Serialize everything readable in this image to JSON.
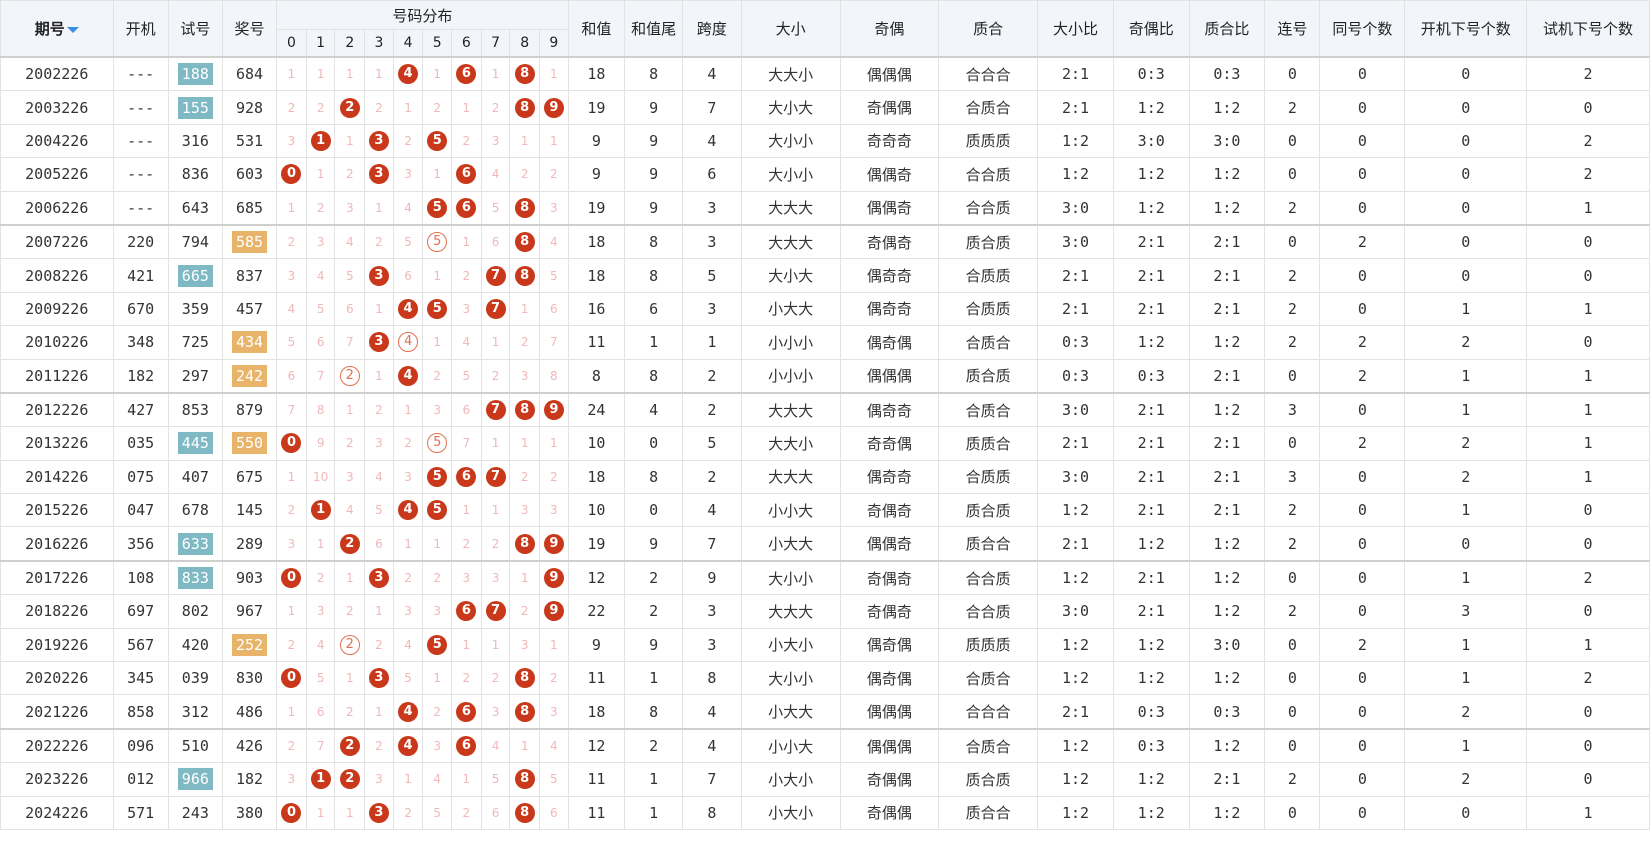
{
  "header": {
    "period": "期号",
    "open_machine": "开机",
    "trial": "试号",
    "prize": "奖号",
    "distribution": "号码分布",
    "digits": [
      "0",
      "1",
      "2",
      "3",
      "4",
      "5",
      "6",
      "7",
      "8",
      "9"
    ],
    "sum": "和值",
    "sum_tail": "和值尾",
    "span": "跨度",
    "big_small": "大小",
    "odd_even": "奇偶",
    "prime_comp": "质合",
    "bs_ratio": "大小比",
    "oe_ratio": "奇偶比",
    "pc_ratio": "质合比",
    "consecutive": "连号",
    "same_count": "同号个数",
    "open_next_count": "开机下号个数",
    "trial_next_count": "试机下号个数"
  },
  "colors": {
    "ball": "#c9381a",
    "ring": "#e07050",
    "tag_teal": "#7fb9c4",
    "tag_orange": "#e8b46a",
    "header_bg": "#f2f6fb",
    "missing": "#f0b8b8"
  },
  "rows": [
    {
      "period": "2002226",
      "open": "---",
      "trial": "188",
      "trial_tag": "teal",
      "prize": "684",
      "prize_tag": "",
      "dist": [
        "1",
        "1",
        "1",
        "1",
        "B4",
        "1",
        "B6",
        "1",
        "B8",
        "1"
      ],
      "sum": "18",
      "tail": "8",
      "span": "4",
      "bs": "大大小",
      "oe": "偶偶偶",
      "pc": "合合合",
      "bsr": "2:1",
      "oer": "0:3",
      "pcr": "0:3",
      "cons": "0",
      "same": "0",
      "onext": "0",
      "tnext": "2"
    },
    {
      "period": "2003226",
      "open": "---",
      "trial": "155",
      "trial_tag": "teal",
      "prize": "928",
      "prize_tag": "",
      "dist": [
        "2",
        "2",
        "B2",
        "2",
        "1",
        "2",
        "1",
        "2",
        "B8",
        "B9"
      ],
      "sum": "19",
      "tail": "9",
      "span": "7",
      "bs": "大小大",
      "oe": "奇偶偶",
      "pc": "合质合",
      "bsr": "2:1",
      "oer": "1:2",
      "pcr": "1:2",
      "cons": "2",
      "same": "0",
      "onext": "0",
      "tnext": "0"
    },
    {
      "period": "2004226",
      "open": "---",
      "trial": "316",
      "trial_tag": "",
      "prize": "531",
      "prize_tag": "",
      "dist": [
        "3",
        "B1",
        "1",
        "B3",
        "2",
        "B5",
        "2",
        "3",
        "1",
        "1"
      ],
      "sum": "9",
      "tail": "9",
      "span": "4",
      "bs": "大小小",
      "oe": "奇奇奇",
      "pc": "质质质",
      "bsr": "1:2",
      "oer": "3:0",
      "pcr": "3:0",
      "cons": "0",
      "same": "0",
      "onext": "0",
      "tnext": "2"
    },
    {
      "period": "2005226",
      "open": "---",
      "trial": "836",
      "trial_tag": "",
      "prize": "603",
      "prize_tag": "",
      "dist": [
        "B0",
        "1",
        "2",
        "B3",
        "3",
        "1",
        "B6",
        "4",
        "2",
        "2"
      ],
      "sum": "9",
      "tail": "9",
      "span": "6",
      "bs": "大小小",
      "oe": "偶偶奇",
      "pc": "合合质",
      "bsr": "1:2",
      "oer": "1:2",
      "pcr": "1:2",
      "cons": "0",
      "same": "0",
      "onext": "0",
      "tnext": "2"
    },
    {
      "period": "2006226",
      "open": "---",
      "trial": "643",
      "trial_tag": "",
      "prize": "685",
      "prize_tag": "",
      "dist": [
        "1",
        "2",
        "3",
        "1",
        "4",
        "B5",
        "B6",
        "5",
        "B8",
        "3"
      ],
      "sum": "19",
      "tail": "9",
      "span": "3",
      "bs": "大大大",
      "oe": "偶偶奇",
      "pc": "合合质",
      "bsr": "3:0",
      "oer": "1:2",
      "pcr": "1:2",
      "cons": "2",
      "same": "0",
      "onext": "0",
      "tnext": "1"
    },
    {
      "period": "2007226",
      "open": "220",
      "trial": "794",
      "trial_tag": "",
      "prize": "585",
      "prize_tag": "orange",
      "dist": [
        "2",
        "3",
        "4",
        "2",
        "5",
        "R5",
        "1",
        "6",
        "B8",
        "4"
      ],
      "sum": "18",
      "tail": "8",
      "span": "3",
      "bs": "大大大",
      "oe": "奇偶奇",
      "pc": "质合质",
      "bsr": "3:0",
      "oer": "2:1",
      "pcr": "2:1",
      "cons": "0",
      "same": "2",
      "onext": "0",
      "tnext": "0"
    },
    {
      "period": "2008226",
      "open": "421",
      "trial": "665",
      "trial_tag": "teal",
      "prize": "837",
      "prize_tag": "",
      "dist": [
        "3",
        "4",
        "5",
        "B3",
        "6",
        "1",
        "2",
        "B7",
        "B8",
        "5"
      ],
      "sum": "18",
      "tail": "8",
      "span": "5",
      "bs": "大小大",
      "oe": "偶奇奇",
      "pc": "合质质",
      "bsr": "2:1",
      "oer": "2:1",
      "pcr": "2:1",
      "cons": "2",
      "same": "0",
      "onext": "0",
      "tnext": "0"
    },
    {
      "period": "2009226",
      "open": "670",
      "trial": "359",
      "trial_tag": "",
      "prize": "457",
      "prize_tag": "",
      "dist": [
        "4",
        "5",
        "6",
        "1",
        "B4",
        "B5",
        "3",
        "B7",
        "1",
        "6"
      ],
      "sum": "16",
      "tail": "6",
      "span": "3",
      "bs": "小大大",
      "oe": "偶奇奇",
      "pc": "合质质",
      "bsr": "2:1",
      "oer": "2:1",
      "pcr": "2:1",
      "cons": "2",
      "same": "0",
      "onext": "1",
      "tnext": "1"
    },
    {
      "period": "2010226",
      "open": "348",
      "trial": "725",
      "trial_tag": "",
      "prize": "434",
      "prize_tag": "orange",
      "dist": [
        "5",
        "6",
        "7",
        "B3",
        "R4",
        "1",
        "4",
        "1",
        "2",
        "7"
      ],
      "sum": "11",
      "tail": "1",
      "span": "1",
      "bs": "小小小",
      "oe": "偶奇偶",
      "pc": "合质合",
      "bsr": "0:3",
      "oer": "1:2",
      "pcr": "1:2",
      "cons": "2",
      "same": "2",
      "onext": "2",
      "tnext": "0"
    },
    {
      "period": "2011226",
      "open": "182",
      "trial": "297",
      "trial_tag": "",
      "prize": "242",
      "prize_tag": "orange",
      "dist": [
        "6",
        "7",
        "R2",
        "1",
        "B4",
        "2",
        "5",
        "2",
        "3",
        "8"
      ],
      "sum": "8",
      "tail": "8",
      "span": "2",
      "bs": "小小小",
      "oe": "偶偶偶",
      "pc": "质合质",
      "bsr": "0:3",
      "oer": "0:3",
      "pcr": "2:1",
      "cons": "0",
      "same": "2",
      "onext": "1",
      "tnext": "1"
    },
    {
      "period": "2012226",
      "open": "427",
      "trial": "853",
      "trial_tag": "",
      "prize": "879",
      "prize_tag": "",
      "dist": [
        "7",
        "8",
        "1",
        "2",
        "1",
        "3",
        "6",
        "B7",
        "B8",
        "B9"
      ],
      "sum": "24",
      "tail": "4",
      "span": "2",
      "bs": "大大大",
      "oe": "偶奇奇",
      "pc": "合质合",
      "bsr": "3:0",
      "oer": "2:1",
      "pcr": "1:2",
      "cons": "3",
      "same": "0",
      "onext": "1",
      "tnext": "1"
    },
    {
      "period": "2013226",
      "open": "035",
      "trial": "445",
      "trial_tag": "teal",
      "prize": "550",
      "prize_tag": "orange",
      "dist": [
        "B0",
        "9",
        "2",
        "3",
        "2",
        "R5",
        "7",
        "1",
        "1",
        "1"
      ],
      "sum": "10",
      "tail": "0",
      "span": "5",
      "bs": "大大小",
      "oe": "奇奇偶",
      "pc": "质质合",
      "bsr": "2:1",
      "oer": "2:1",
      "pcr": "2:1",
      "cons": "0",
      "same": "2",
      "onext": "2",
      "tnext": "1"
    },
    {
      "period": "2014226",
      "open": "075",
      "trial": "407",
      "trial_tag": "",
      "prize": "675",
      "prize_tag": "",
      "dist": [
        "1",
        "10",
        "3",
        "4",
        "3",
        "B5",
        "B6",
        "B7",
        "2",
        "2"
      ],
      "sum": "18",
      "tail": "8",
      "span": "2",
      "bs": "大大大",
      "oe": "偶奇奇",
      "pc": "合质质",
      "bsr": "3:0",
      "oer": "2:1",
      "pcr": "2:1",
      "cons": "3",
      "same": "0",
      "onext": "2",
      "tnext": "1"
    },
    {
      "period": "2015226",
      "open": "047",
      "trial": "678",
      "trial_tag": "",
      "prize": "145",
      "prize_tag": "",
      "dist": [
        "2",
        "B1",
        "4",
        "5",
        "B4",
        "B5",
        "1",
        "1",
        "3",
        "3"
      ],
      "sum": "10",
      "tail": "0",
      "span": "4",
      "bs": "小小大",
      "oe": "奇偶奇",
      "pc": "质合质",
      "bsr": "1:2",
      "oer": "2:1",
      "pcr": "2:1",
      "cons": "2",
      "same": "0",
      "onext": "1",
      "tnext": "0"
    },
    {
      "period": "2016226",
      "open": "356",
      "trial": "633",
      "trial_tag": "teal",
      "prize": "289",
      "prize_tag": "",
      "dist": [
        "3",
        "1",
        "B2",
        "6",
        "1",
        "1",
        "2",
        "2",
        "B8",
        "B9"
      ],
      "sum": "19",
      "tail": "9",
      "span": "7",
      "bs": "小大大",
      "oe": "偶偶奇",
      "pc": "质合合",
      "bsr": "2:1",
      "oer": "1:2",
      "pcr": "1:2",
      "cons": "2",
      "same": "0",
      "onext": "0",
      "tnext": "0"
    },
    {
      "period": "2017226",
      "open": "108",
      "trial": "833",
      "trial_tag": "teal",
      "prize": "903",
      "prize_tag": "",
      "dist": [
        "B0",
        "2",
        "1",
        "B3",
        "2",
        "2",
        "3",
        "3",
        "1",
        "B9"
      ],
      "sum": "12",
      "tail": "2",
      "span": "9",
      "bs": "大小小",
      "oe": "奇偶奇",
      "pc": "合合质",
      "bsr": "1:2",
      "oer": "2:1",
      "pcr": "1:2",
      "cons": "0",
      "same": "0",
      "onext": "1",
      "tnext": "2"
    },
    {
      "period": "2018226",
      "open": "697",
      "trial": "802",
      "trial_tag": "",
      "prize": "967",
      "prize_tag": "",
      "dist": [
        "1",
        "3",
        "2",
        "1",
        "3",
        "3",
        "B6",
        "B7",
        "2",
        "B9"
      ],
      "sum": "22",
      "tail": "2",
      "span": "3",
      "bs": "大大大",
      "oe": "奇偶奇",
      "pc": "合合质",
      "bsr": "3:0",
      "oer": "2:1",
      "pcr": "1:2",
      "cons": "2",
      "same": "0",
      "onext": "3",
      "tnext": "0"
    },
    {
      "period": "2019226",
      "open": "567",
      "trial": "420",
      "trial_tag": "",
      "prize": "252",
      "prize_tag": "orange",
      "dist": [
        "2",
        "4",
        "R2",
        "2",
        "4",
        "B5",
        "1",
        "1",
        "3",
        "1"
      ],
      "sum": "9",
      "tail": "9",
      "span": "3",
      "bs": "小大小",
      "oe": "偶奇偶",
      "pc": "质质质",
      "bsr": "1:2",
      "oer": "1:2",
      "pcr": "3:0",
      "cons": "0",
      "same": "2",
      "onext": "1",
      "tnext": "1"
    },
    {
      "period": "2020226",
      "open": "345",
      "trial": "039",
      "trial_tag": "",
      "prize": "830",
      "prize_tag": "",
      "dist": [
        "B0",
        "5",
        "1",
        "B3",
        "5",
        "1",
        "2",
        "2",
        "B8",
        "2"
      ],
      "sum": "11",
      "tail": "1",
      "span": "8",
      "bs": "大小小",
      "oe": "偶奇偶",
      "pc": "合质合",
      "bsr": "1:2",
      "oer": "1:2",
      "pcr": "1:2",
      "cons": "0",
      "same": "0",
      "onext": "1",
      "tnext": "2"
    },
    {
      "period": "2021226",
      "open": "858",
      "trial": "312",
      "trial_tag": "",
      "prize": "486",
      "prize_tag": "",
      "dist": [
        "1",
        "6",
        "2",
        "1",
        "B4",
        "2",
        "B6",
        "3",
        "B8",
        "3"
      ],
      "sum": "18",
      "tail": "8",
      "span": "4",
      "bs": "小大大",
      "oe": "偶偶偶",
      "pc": "合合合",
      "bsr": "2:1",
      "oer": "0:3",
      "pcr": "0:3",
      "cons": "0",
      "same": "0",
      "onext": "2",
      "tnext": "0"
    },
    {
      "period": "2022226",
      "open": "096",
      "trial": "510",
      "trial_tag": "",
      "prize": "426",
      "prize_tag": "",
      "dist": [
        "2",
        "7",
        "B2",
        "2",
        "B4",
        "3",
        "B6",
        "4",
        "1",
        "4"
      ],
      "sum": "12",
      "tail": "2",
      "span": "4",
      "bs": "小小大",
      "oe": "偶偶偶",
      "pc": "合质合",
      "bsr": "1:2",
      "oer": "0:3",
      "pcr": "1:2",
      "cons": "0",
      "same": "0",
      "onext": "1",
      "tnext": "0"
    },
    {
      "period": "2023226",
      "open": "012",
      "trial": "966",
      "trial_tag": "teal",
      "prize": "182",
      "prize_tag": "",
      "dist": [
        "3",
        "B1",
        "B2",
        "3",
        "1",
        "4",
        "1",
        "5",
        "B8",
        "5"
      ],
      "sum": "11",
      "tail": "1",
      "span": "7",
      "bs": "小大小",
      "oe": "奇偶偶",
      "pc": "质合质",
      "bsr": "1:2",
      "oer": "1:2",
      "pcr": "2:1",
      "cons": "2",
      "same": "0",
      "onext": "2",
      "tnext": "0"
    },
    {
      "period": "2024226",
      "open": "571",
      "trial": "243",
      "trial_tag": "",
      "prize": "380",
      "prize_tag": "",
      "dist": [
        "B0",
        "1",
        "1",
        "B3",
        "2",
        "5",
        "2",
        "6",
        "B8",
        "6"
      ],
      "sum": "11",
      "tail": "1",
      "span": "8",
      "bs": "小大小",
      "oe": "奇偶偶",
      "pc": "质合合",
      "bsr": "1:2",
      "oer": "1:2",
      "pcr": "1:2",
      "cons": "0",
      "same": "0",
      "onext": "0",
      "tnext": "1"
    }
  ]
}
